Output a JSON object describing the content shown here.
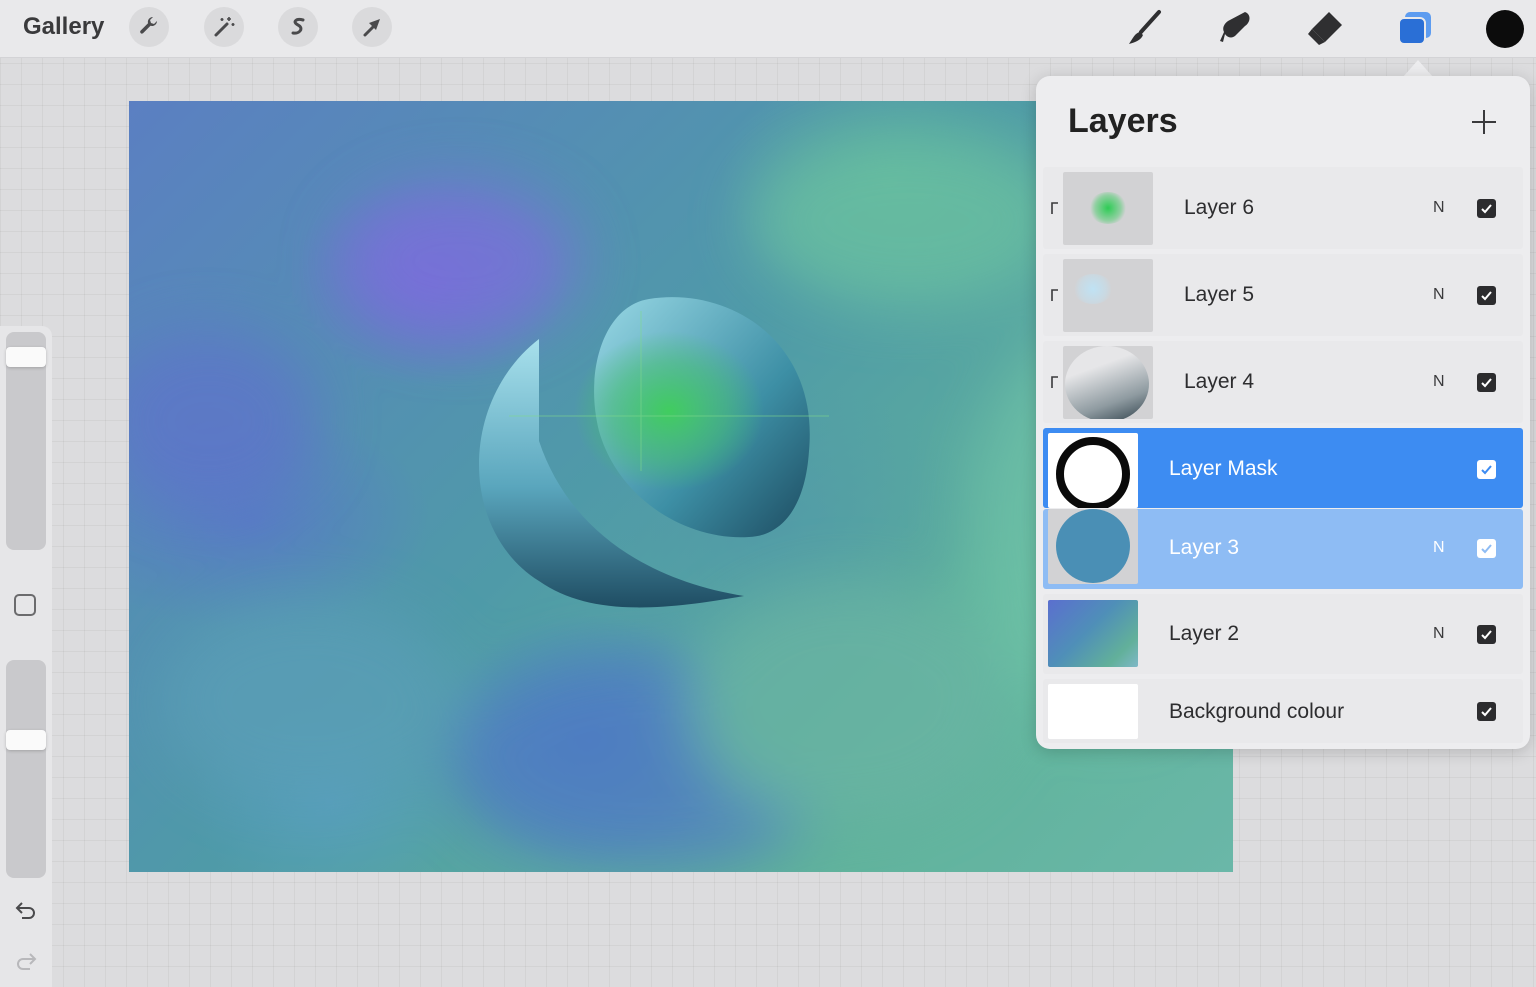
{
  "topbar": {
    "gallery_label": "Gallery",
    "left_tools": [
      "wrench-icon",
      "magic-wand-icon",
      "selection-s-icon",
      "transform-arrow-icon"
    ],
    "right_tools": [
      "brush-icon",
      "smudge-icon",
      "eraser-icon",
      "layers-icon"
    ],
    "current_color": "#0c0c0c"
  },
  "layers_panel": {
    "title": "Layers",
    "add_icon": "plus-icon",
    "layers": [
      {
        "name": "Layer 6",
        "mode": "N",
        "visible": true,
        "clipped": true
      },
      {
        "name": "Layer 5",
        "mode": "N",
        "visible": true,
        "clipped": true
      },
      {
        "name": "Layer 4",
        "mode": "N",
        "visible": true,
        "clipped": true
      },
      {
        "name": "Layer Mask",
        "mode": "",
        "visible": true,
        "selected": true
      },
      {
        "name": "Layer 3",
        "mode": "N",
        "visible": true,
        "selected": true
      },
      {
        "name": "Layer 2",
        "mode": "N",
        "visible": true
      },
      {
        "name": "Background colour",
        "mode": "",
        "visible": true
      }
    ]
  },
  "sidebar": {
    "brush_size_level": 0.95,
    "opacity_level": 0.6,
    "icons": [
      "modify-square-icon",
      "undo-icon",
      "redo-icon"
    ]
  },
  "colors": {
    "selected_primary": "#3d8cf2",
    "selected_secondary": "#8ebcf4",
    "accent_layers_icon": "#2a6fd6"
  }
}
